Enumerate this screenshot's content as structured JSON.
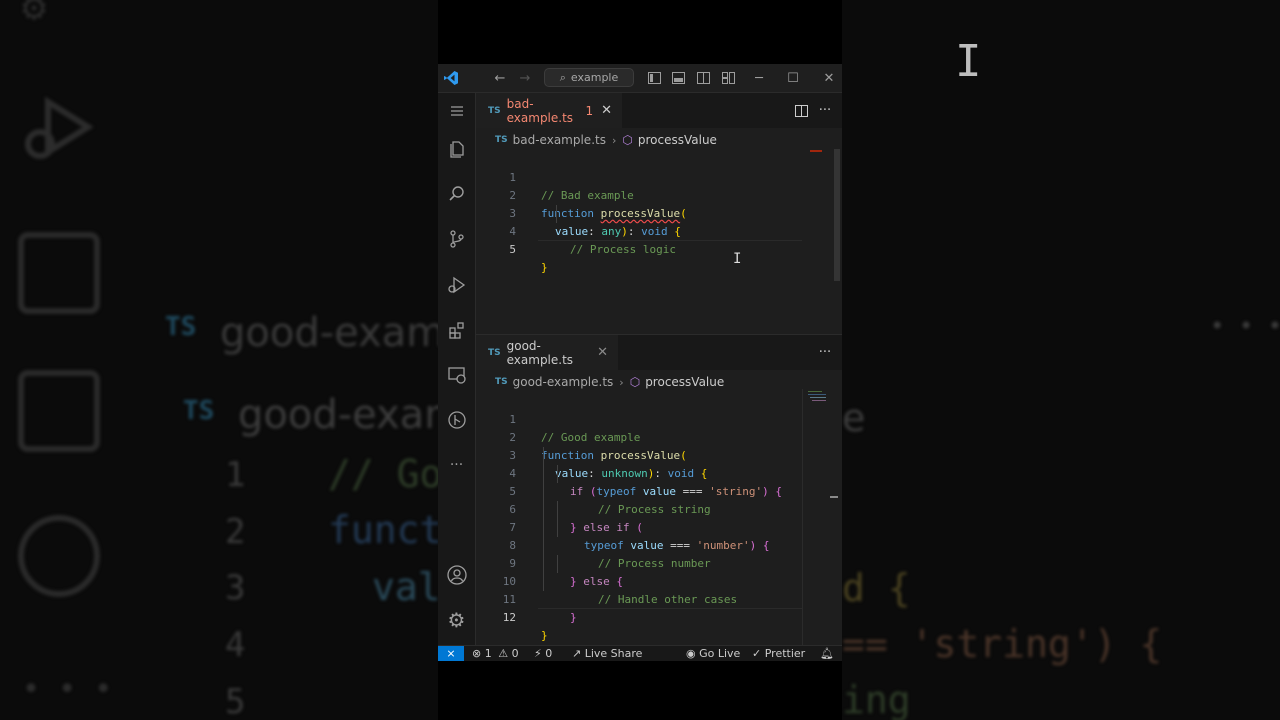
{
  "titlebar": {
    "search_label": "example"
  },
  "editor_top": {
    "tab_label": "bad-example.ts",
    "tab_problem_count": "1",
    "tab_lang": "TS",
    "breadcrumb_file": "bad-example.ts",
    "breadcrumb_symbol": "processValue",
    "line_numbers": [
      "1",
      "2",
      "3",
      "4",
      "5"
    ]
  },
  "editor_bottom": {
    "tab_label": "good-example.ts",
    "tab_lang": "TS",
    "breadcrumb_file": "good-example.ts",
    "breadcrumb_symbol": "processValue",
    "line_numbers": [
      "1",
      "2",
      "3",
      "4",
      "5",
      "6",
      "7",
      "8",
      "9",
      "10",
      "11",
      "12"
    ]
  },
  "code_top": {
    "l1_comment": "// Bad example",
    "l2_kw": "function",
    "l2_fn": "processValue",
    "l2_paren": "(",
    "l3_param": "value",
    "l3_colon": ": ",
    "l3_type": "any",
    "l3_close": ")",
    "l3_colon2": ": ",
    "l3_ret": "void",
    "l3_brace": "{",
    "l4_comment": "// Process logic",
    "l5_brace": "}"
  },
  "code_bottom": {
    "l1_comment": "// Good example",
    "l2_kw": "function",
    "l2_fn": "processValue",
    "l2_paren": "(",
    "l3_param": "value",
    "l3_type": "unknown",
    "l3_ret": "void",
    "l4_if": "if",
    "l4_typeof": "typeof",
    "l4_var": "value",
    "l4_op": "===",
    "l4_str": "'string'",
    "l5_comment": "// Process string",
    "l6_else": "else if",
    "l7_typeof": "typeof",
    "l7_var": "value",
    "l7_op": "===",
    "l7_str": "'number'",
    "l8_comment": "// Process number",
    "l9_else": "else",
    "l10_comment": "// Handle other cases"
  },
  "statusbar": {
    "errors": "1",
    "warnings": "0",
    "ports": "0",
    "live_share": "Live Share",
    "go_live": "Go Live",
    "prettier": "Prettier"
  },
  "background": {
    "echo_tab": "good-example",
    "echo_tab2": "good-examp",
    "echo_ts": "TS",
    "echo_l1": "1",
    "echo_l2": "2",
    "echo_l3": "3",
    "echo_l4": "4",
    "echo_l5": "5",
    "echo_cmt": "// Go",
    "echo_fn": "funct",
    "echo_val": "val",
    "echo_right1": "e",
    "echo_right2": "d {",
    "echo_right3": "== 'string') {",
    "echo_right4": "ing"
  },
  "colors": {
    "accent": "#0078d4",
    "error": "#f14c4c",
    "comment": "#6a9955",
    "keyword": "#569cd6"
  }
}
